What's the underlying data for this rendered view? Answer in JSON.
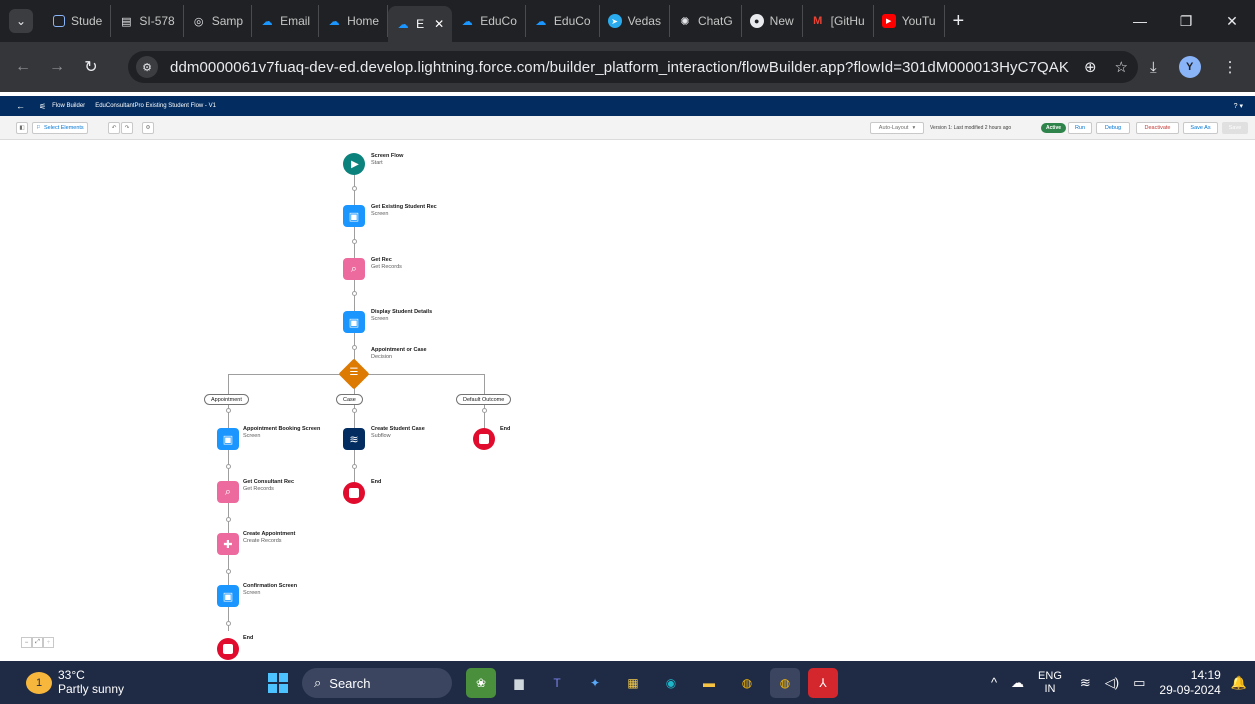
{
  "browser": {
    "tabs": [
      {
        "label": "Stude",
        "icon": "square-outline-icon",
        "color": "#8ab4f8"
      },
      {
        "label": "SI-578",
        "icon": "notebook-icon",
        "color": "#e8eaed"
      },
      {
        "label": "Samp",
        "icon": "globe-icon",
        "color": "#e8eaed"
      },
      {
        "label": "Email",
        "icon": "salesforce-cloud-icon",
        "color": "#1b96ff"
      },
      {
        "label": "Home",
        "icon": "salesforce-cloud-icon",
        "color": "#1b96ff"
      },
      {
        "label": "E",
        "icon": "salesforce-cloud-icon",
        "color": "#1b96ff",
        "active": true
      },
      {
        "label": "EduCo",
        "icon": "salesforce-cloud-icon",
        "color": "#1b96ff"
      },
      {
        "label": "EduCo",
        "icon": "salesforce-cloud-icon",
        "color": "#1b96ff"
      },
      {
        "label": "Vedas",
        "icon": "telegram-icon",
        "color": "#2aabee"
      },
      {
        "label": "ChatG",
        "icon": "chatgpt-icon",
        "color": "#e8eaed"
      },
      {
        "label": "New",
        "icon": "github-icon",
        "color": "#e8eaed"
      },
      {
        "label": "[GitHu",
        "icon": "gmail-icon",
        "color": "#ea4335"
      },
      {
        "label": "YouTu",
        "icon": "youtube-icon",
        "color": "#ff0000"
      }
    ],
    "url": "ddm0000061v7fuaq-dev-ed.develop.lightning.force.com/builder_platform_interaction/flowBuilder.app?flowId=301dM000013HyC7QAK",
    "profile_initial": "Y"
  },
  "sf": {
    "app_label": "Flow Builder",
    "flow_name": "EduConsultantPro Existing Student Flow - V1",
    "help": "? ▾"
  },
  "toolbar": {
    "select_elements": "Select Elements",
    "auto_layout": "Auto-Layout",
    "version_status": "Version 1: Last modified 2 hours ago",
    "active_badge": "Active",
    "run": "Run",
    "debug": "Debug",
    "deactivate": "Deactivate",
    "save_as": "Save As",
    "save": "Save"
  },
  "flow": {
    "start": {
      "title": "Screen Flow",
      "subtitle": "Start"
    },
    "get_existing": {
      "title": "Get Existing Student Rec",
      "subtitle": "Screen"
    },
    "get_rec": {
      "title": "Get Rec",
      "subtitle": "Get Records"
    },
    "display_details": {
      "title": "Display Student Details",
      "subtitle": "Screen"
    },
    "decision": {
      "title": "Appointment or Case",
      "subtitle": "Decision"
    },
    "outcomes": [
      "Appointment",
      "Case",
      "Default Outcome"
    ],
    "appt_booking": {
      "title": "Appointment Booking Screen",
      "subtitle": "Screen"
    },
    "create_case": {
      "title": "Create Student Case",
      "subtitle": "Subflow"
    },
    "default_end": "End",
    "case_end": "End",
    "get_consultant": {
      "title": "Get Consultant Rec",
      "subtitle": "Get Records"
    },
    "create_appt": {
      "title": "Create Appointment",
      "subtitle": "Create Records"
    },
    "confirmation": {
      "title": "Confirmation Screen",
      "subtitle": "Screen"
    },
    "final_end": "End"
  },
  "taskbar": {
    "weather_temp": "33°C",
    "weather_desc": "Partly sunny",
    "weather_badge": "1",
    "search": "Search",
    "lang_top": "ENG",
    "lang_bottom": "IN",
    "time": "14:19",
    "date": "29-09-2024"
  },
  "colors": {
    "sf_navy": "#032d60",
    "screen_blue": "#1b96ff",
    "records_pink": "#ec6a9d",
    "decision_orange": "#dd7a01",
    "start_teal": "#0b827c",
    "end_red": "#e10c2d",
    "active_green": "#2e844a"
  }
}
